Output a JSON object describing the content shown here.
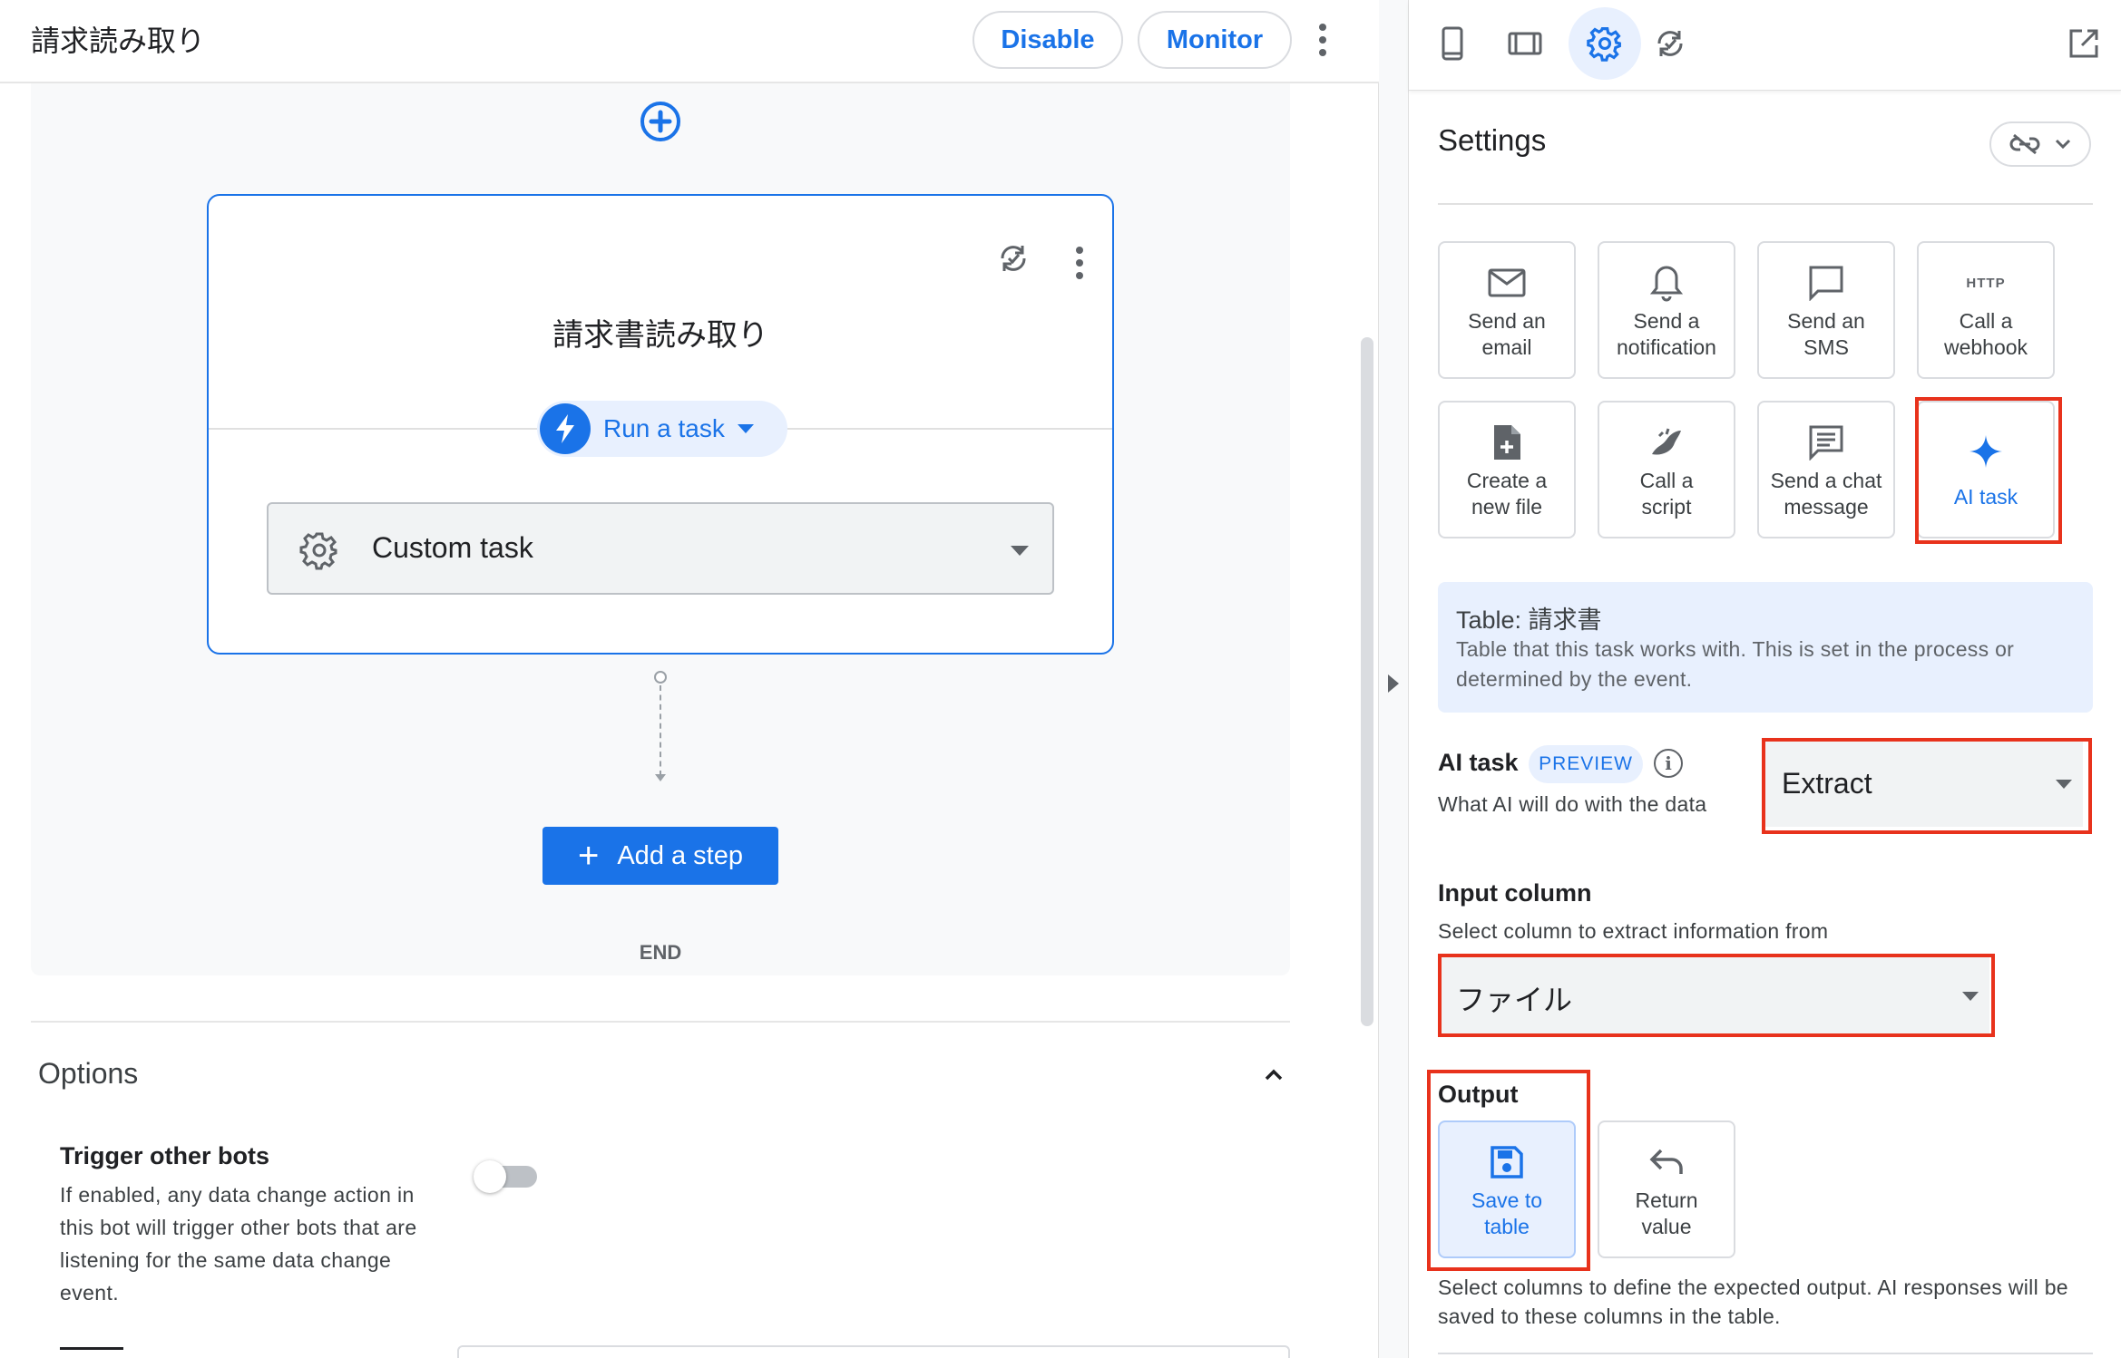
{
  "left_panel": {
    "bot_title": "請求読み取り",
    "disable_label": "Disable",
    "monitor_label": "Monitor",
    "step": {
      "title": "請求書読み取り",
      "run_task_label": "Run a task",
      "task_select_value": "Custom task"
    },
    "add_step_label": "Add a step",
    "end_label": "END",
    "options": {
      "title": "Options",
      "trigger_title": "Trigger other bots",
      "trigger_desc": "If enabled, any data change action in this bot will trigger other bots that are listening for the same data change event.",
      "trigger_enabled": false
    }
  },
  "right_panel": {
    "toolbar_icons": [
      "phone-icon",
      "tablet-icon",
      "gear-icon",
      "sync-check-icon",
      "open-in-new-icon"
    ],
    "settings_title": "Settings",
    "task_tiles": [
      {
        "icon": "envelope-icon",
        "line1": "Send an",
        "line2": "email"
      },
      {
        "icon": "bell-icon",
        "line1": "Send a",
        "line2": "notification"
      },
      {
        "icon": "chat-bubble-icon",
        "line1": "Send an",
        "line2": "SMS"
      },
      {
        "icon": "http-icon",
        "icon_text": "HTTP",
        "line1": "Call a",
        "line2": "webhook"
      },
      {
        "icon": "new-file-icon",
        "line1": "Create a",
        "line2": "new file"
      },
      {
        "icon": "script-icon",
        "line1": "Call a",
        "line2": "script"
      },
      {
        "icon": "message-icon",
        "line1": "Send a chat",
        "line2": "message"
      },
      {
        "icon": "sparkle-icon",
        "line1": "AI task",
        "line2": ""
      }
    ],
    "table_info": {
      "title": "Table: 請求書",
      "desc": "Table that this task works with. This is set in the process or determined by the event."
    },
    "ai_task": {
      "label": "AI task",
      "badge": "PREVIEW",
      "desc": "What AI will do with the data",
      "value": "Extract"
    },
    "input_column": {
      "title": "Input column",
      "desc": "Select column to extract information from",
      "value": "ファイル"
    },
    "output": {
      "title": "Output",
      "options": [
        {
          "icon": "save-icon",
          "line1": "Save to",
          "line2": "table",
          "selected": true
        },
        {
          "icon": "return-icon",
          "line1": "Return",
          "line2": "value",
          "selected": false
        }
      ],
      "desc": "Select columns to define the expected output. AI responses will be saved to these columns in the table."
    }
  },
  "colors": {
    "accent": "#1a73e8",
    "highlight_red": "#e8321c",
    "info_bg": "#e8f0fe"
  }
}
